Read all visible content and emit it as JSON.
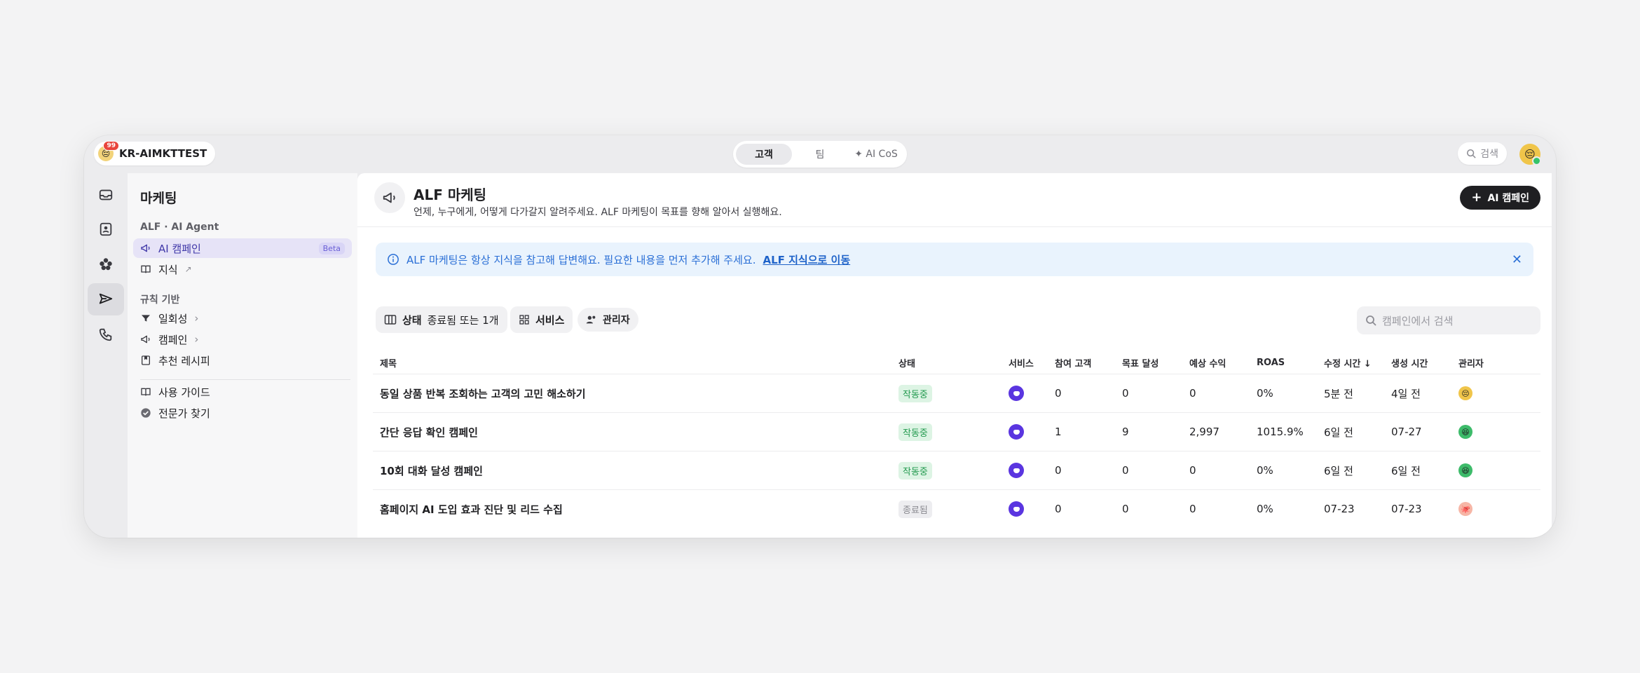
{
  "topbar": {
    "workspace_name": "KR-AIMKTTEST",
    "workspace_badge": "99",
    "tabs": [
      {
        "label": "고객",
        "active": true
      },
      {
        "label": "팀",
        "active": false
      },
      {
        "label": "✦ AI CoS",
        "active": false
      }
    ],
    "search_label": "검색"
  },
  "panel": {
    "title": "마케팅",
    "section_ai": "ALF · AI Agent",
    "items_ai": [
      {
        "label": "AI 캠페인",
        "badge": "Beta",
        "icon": "megaphone-icon"
      },
      {
        "label": "지식",
        "suffix": "↗",
        "icon": "book-icon"
      }
    ],
    "section_rules": "규칙 기반",
    "items_rules": [
      {
        "label": "일회성",
        "icon": "filter-icon"
      },
      {
        "label": "캠페인",
        "icon": "megaphone-icon"
      },
      {
        "label": "추천 레시피",
        "icon": "bookmark-icon"
      }
    ],
    "items_bottom": [
      {
        "label": "사용 가이드",
        "icon": "book-icon"
      },
      {
        "label": "전문가 찾기",
        "icon": "verified-icon"
      }
    ]
  },
  "main": {
    "title": "ALF 마케팅",
    "subtitle": "언제, 누구에게, 어떻게 다가갈지 알려주세요. ALF 마케팅이 목표를 향해 알아서 실행해요.",
    "new_button": "AI 캠페인",
    "alert_text": "ALF 마케팅은 항상 지식을 참고해 답변해요. 필요한 내용을 먼저 추가해 주세요.",
    "alert_link": "ALF 지식으로 이동",
    "filters": {
      "status_label": "상태",
      "status_value": "종료됨 또는 1개",
      "service_label": "서비스",
      "manager_label": "관리자"
    },
    "search_placeholder": "캠페인에서 검색",
    "columns": [
      "제목",
      "상태",
      "서비스",
      "참여 고객",
      "목표 달성",
      "예상 수익",
      "ROAS",
      "수정 시간 ↓",
      "생성 시간",
      "관리자"
    ],
    "rows": [
      {
        "title": "동일 상품 반복 조회하는 고객의 고민 해소하기",
        "status": "작동중",
        "participants": "0",
        "goals": "0",
        "revenue": "0",
        "roas": "0%",
        "modified": "5분 전",
        "created": "4일 전",
        "manager_emoji": "😔",
        "manager_color": "#f0c54a"
      },
      {
        "title": "간단 응답 확인 캠페인",
        "status": "작동중",
        "participants": "1",
        "goals": "9",
        "revenue": "2,997",
        "roas": "1015.9%",
        "modified": "6일 전",
        "created": "07-27",
        "manager_emoji": "😆",
        "manager_color": "#3dbb6a"
      },
      {
        "title": "10회 대화 달성 캠페인",
        "status": "작동중",
        "participants": "0",
        "goals": "0",
        "revenue": "0",
        "roas": "0%",
        "modified": "6일 전",
        "created": "6일 전",
        "manager_emoji": "😆",
        "manager_color": "#3dbb6a"
      },
      {
        "title": "홈페이지 AI 도입 효과 진단 및 리드 수집",
        "status": "종료됨",
        "participants": "0",
        "goals": "0",
        "revenue": "0",
        "roas": "0%",
        "modified": "07-23",
        "created": "07-23",
        "manager_emoji": "🐙",
        "manager_color": "#f6b6a6"
      }
    ]
  },
  "colors": {
    "accent": "#5a35e0",
    "status_on": "#239a4f",
    "info": "#2a6fd6"
  }
}
